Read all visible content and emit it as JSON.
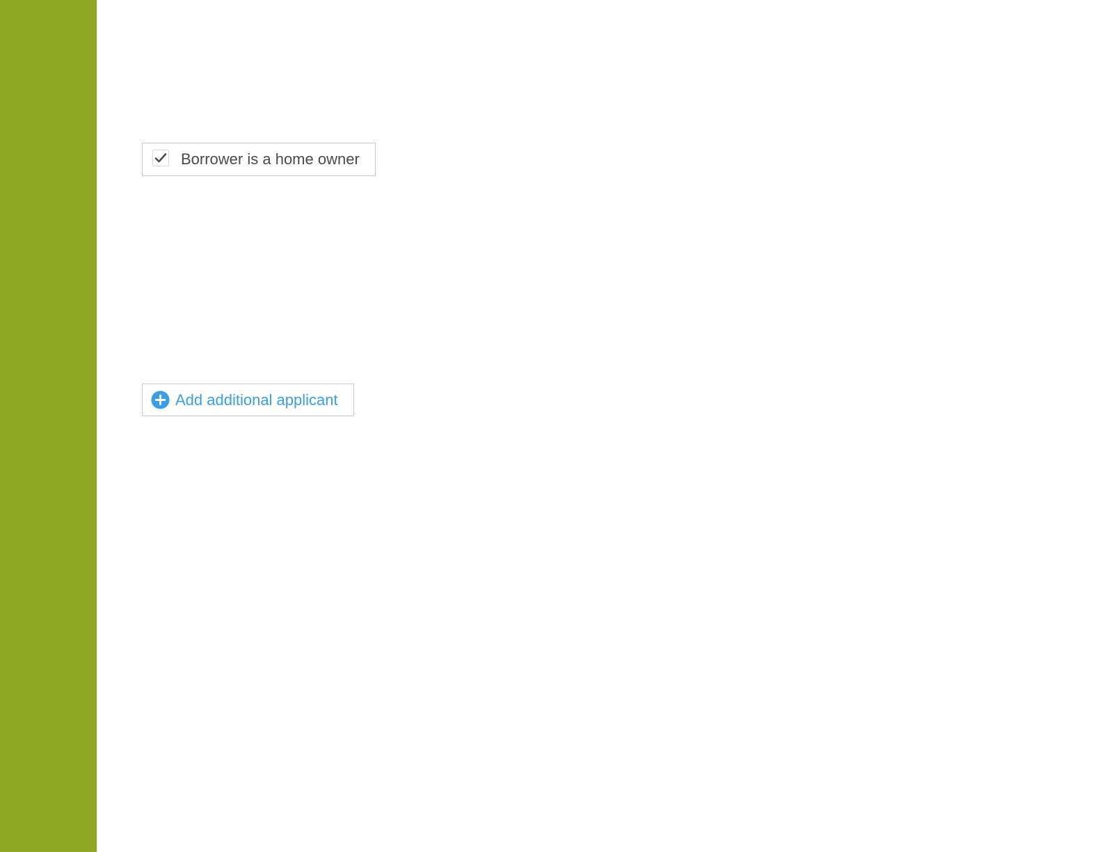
{
  "colors": {
    "sidebar_bg": "#8fa724",
    "accent_blue": "#3a9ee4",
    "text_dark": "#4a4a4a"
  },
  "form": {
    "home_owner": {
      "label": "Borrower is a home owner",
      "checked": true,
      "icon": "checkmark-icon"
    },
    "add_applicant": {
      "label": "Add additional applicant",
      "icon": "plus-circle-icon"
    }
  }
}
